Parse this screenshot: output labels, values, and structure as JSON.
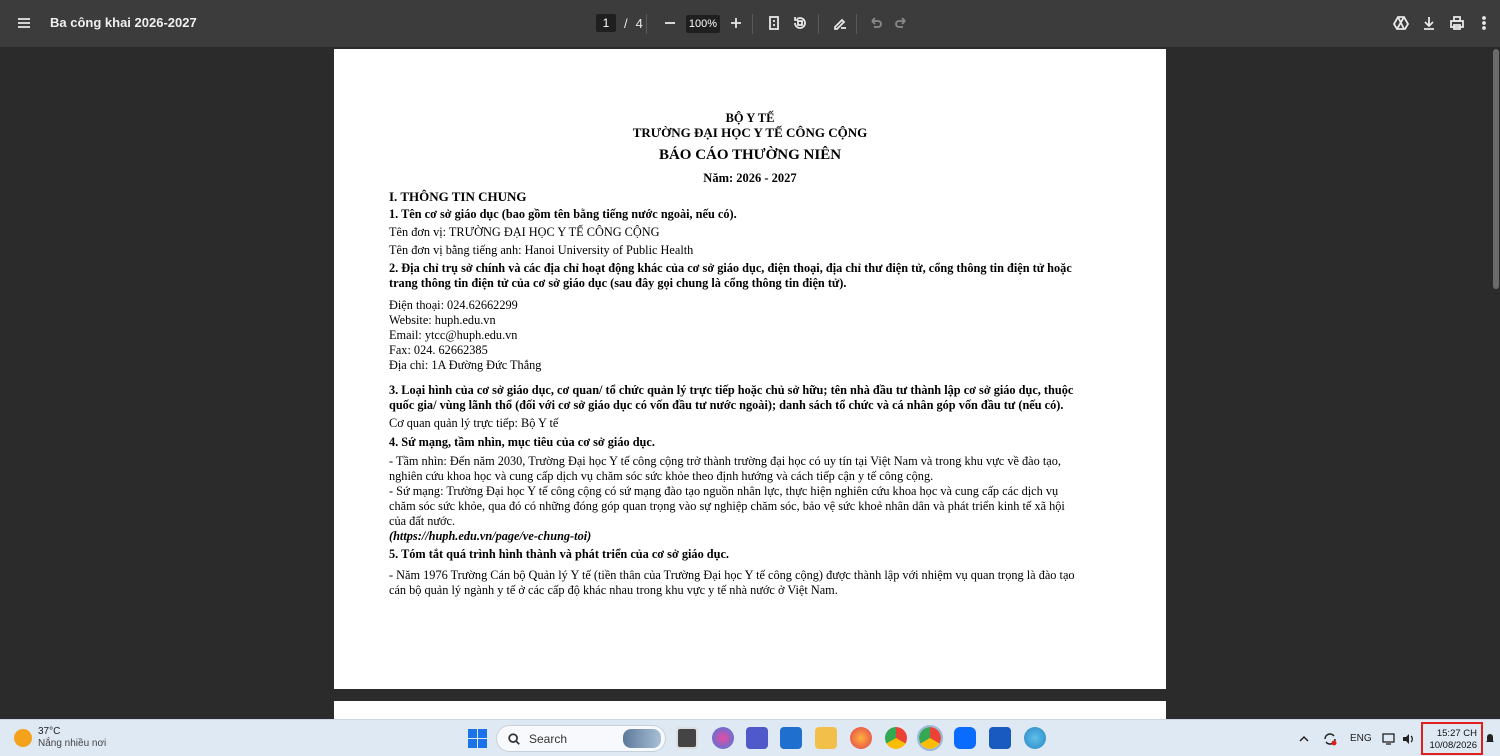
{
  "toolbar": {
    "title": "Ba công khai 2026-2027",
    "page_current": "1",
    "page_sep": "/",
    "page_total": "4",
    "zoom": "100%"
  },
  "document": {
    "ministry": "BỘ Y TẾ",
    "university": "TRƯỜNG ĐẠI HỌC Y TẾ CÔNG CỘNG",
    "report_title": "BÁO CÁO THƯỜNG NIÊN",
    "year": "Năm: 2026 - 2027",
    "section1": "I. THÔNG TIN CHUNG",
    "s1_heading": "1. Tên cơ sở giáo dục (bao gồm tên bằng tiếng nước ngoài, nếu có).",
    "s1_name": "Tên đơn vị: TRƯỜNG ĐẠI HỌC Y TẾ CÔNG CỘNG",
    "s1_name_en": "Tên đơn vị bằng tiếng anh: Hanoi University of Public Health",
    "s2_heading_1": "2. Địa chỉ trụ sở chính và các địa chỉ hoạt động khác của cơ sở giáo dục, điện thoại, địa chỉ thư điện tử, cổng thông tin điện tử hoặc",
    "s2_heading_2": "trang thông tin điện tử của cơ sở giáo dục (sau đây gọi chung là cổng thông tin điện tử).",
    "s2_phone": "Điện thoại: 024.62662299",
    "s2_web": "Website: huph.edu.vn",
    "s2_email": "Email: ytcc@huph.edu.vn",
    "s2_fax": "Fax: 024. 62662385",
    "s2_address": "Địa chỉ: 1A Đường Đức Thắng",
    "s3_heading_1": "3. Loại hình của cơ sở giáo dục, cơ quan/ tổ chức quản lý trực tiếp hoặc chủ sở hữu; tên nhà đầu tư thành lập cơ sở giáo dục, thuộc",
    "s3_heading_2": "quốc gia/ vùng lãnh thổ (đối với cơ sở giáo dục có vốn đầu tư nước ngoài); danh sách tổ chức và cá nhân góp vốn đầu tư (nếu có).",
    "s3_body": "Cơ quan quản lý trực tiếp: Bộ Y tế",
    "s4_heading": "4. Sứ mạng, tầm nhìn, mục tiêu của cơ sở giáo dục.",
    "s4_vision_1": " - Tầm nhìn: Đến năm 2030, Trường Đại học Y tế công cộng trở thành trường đại học có uy tín tại Việt Nam và trong khu vực về đào tạo,",
    "s4_vision_2": "nghiên cứu khoa học và cung cấp dịch vụ chăm sóc sức khỏe theo định hướng và cách tiếp cận y tế công cộng.",
    "s4_mission_1": " - Sứ mạng: Trường Đại học Y tế công cộng có sứ mạng đào tạo nguồn nhân lực, thực hiện nghiên cứu khoa học và cung cấp các dịch vụ",
    "s4_mission_2": "chăm sóc sức khỏe, qua đó có những đóng góp quan trọng vào sự nghiệp chăm sóc, bảo vệ sức khoẻ nhân dân và phát triển kinh tế xã hội",
    "s4_mission_3": "của đất nước.",
    "s4_link": "(https://huph.edu.vn/page/ve-chung-toi)",
    "s5_heading": "5. Tóm tắt quá trình hình thành và phát triển của cơ sở giáo dục.",
    "s5_body_1": " - Năm 1976 Trường Cán bộ Quản lý Y tế (tiền thân của Trường Đại học Y tế công cộng) được thành lập với nhiệm vụ quan trọng là đào tạo",
    "s5_body_2": "cán bộ quản lý ngành y tế ở các cấp độ khác nhau trong khu vực y tế nhà nước ở Việt Nam."
  },
  "taskbar": {
    "temperature": "37°C",
    "weather_desc": "Nắng nhiều nơi",
    "search_label": "Search",
    "language": "ENG",
    "time": "15:27 CH",
    "date": "10/08/2026"
  },
  "colors": {
    "toolbar_bg": "#3c3c3c",
    "viewer_bg": "#2b2b2b",
    "taskbar_bg": "#dfe9f4",
    "clock_highlight": "#e0201c"
  }
}
